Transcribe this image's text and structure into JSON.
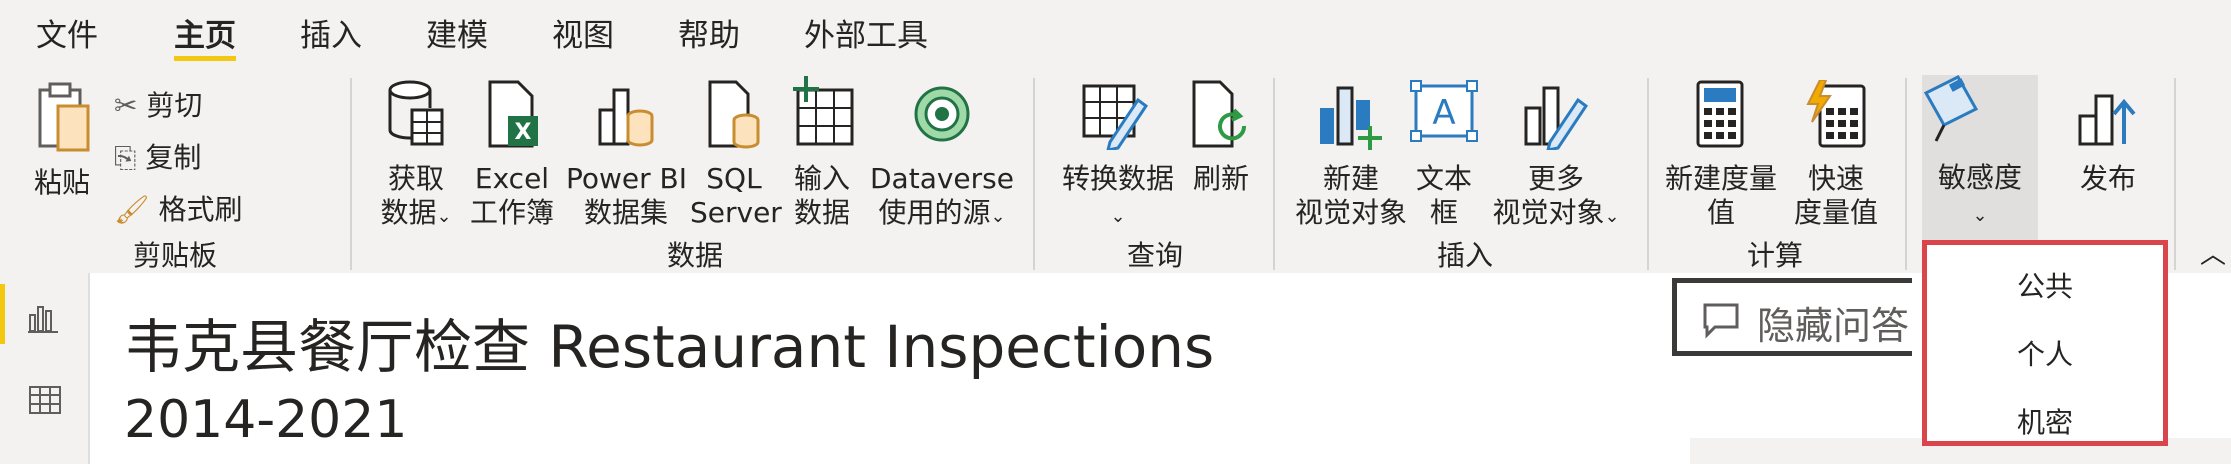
{
  "tabs": [
    {
      "label": "文件",
      "active": false
    },
    {
      "label": "主页",
      "active": true
    },
    {
      "label": "插入",
      "active": false
    },
    {
      "label": "建模",
      "active": false
    },
    {
      "label": "视图",
      "active": false
    },
    {
      "label": "帮助",
      "active": false
    },
    {
      "label": "外部工具",
      "active": false
    }
  ],
  "clipboard": {
    "group_label": "剪贴板",
    "paste": "粘贴",
    "cut": "剪切",
    "copy": "复制",
    "format_painter": "格式刷"
  },
  "data_group": {
    "group_label": "数据",
    "get_data": [
      "获取",
      "数据"
    ],
    "excel": [
      "Excel",
      "工作簿"
    ],
    "powerbi": [
      "Power BI",
      "数据集"
    ],
    "sql": [
      "SQL",
      "Server"
    ],
    "enter_data": [
      "输入",
      "数据"
    ],
    "dataverse": [
      "Dataverse",
      "使用的源"
    ]
  },
  "query_group": {
    "group_label": "查询",
    "transform": "转换数据",
    "refresh": "刷新"
  },
  "insert_group": {
    "group_label": "插入",
    "new_visual": [
      "新建",
      "视觉对象"
    ],
    "text_box": [
      "文本",
      "框"
    ],
    "more_visuals": [
      "更多",
      "视觉对象"
    ]
  },
  "calc_group": {
    "group_label": "计算",
    "new_measure": [
      "新建度量",
      "值"
    ],
    "quick_measure": [
      "快速",
      "度量值"
    ]
  },
  "sensitivity": {
    "label": "敏感度"
  },
  "publish": {
    "label": "发布"
  },
  "sensitivity_menu": {
    "items": [
      "公共",
      "个人",
      "机密"
    ]
  },
  "report": {
    "title": "韦克县餐厅检查 Restaurant Inspections",
    "subtitle": "2014-2021",
    "qa_button": "隐藏问答"
  },
  "colors": {
    "accent": "#f2c811",
    "highlight_border": "#d9454a",
    "excel_green": "#217346"
  }
}
